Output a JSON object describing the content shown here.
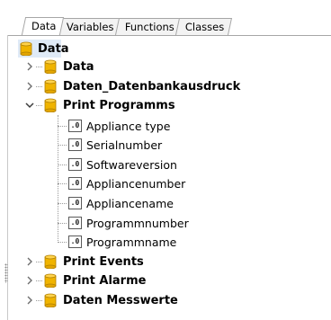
{
  "tabs": [
    {
      "label": "Data",
      "active": true
    },
    {
      "label": "Variables",
      "active": false
    },
    {
      "label": "Functions",
      "active": false
    },
    {
      "label": "Classes",
      "active": false
    }
  ],
  "tree": {
    "root": {
      "label": "Data",
      "icon": "database-icon"
    },
    "nodes": [
      {
        "label": "Data",
        "expanded": false
      },
      {
        "label": "Daten_Datenbankausdruck",
        "expanded": false
      },
      {
        "label": "Print Programms",
        "expanded": true,
        "children": [
          {
            "label": "Appliance type",
            "icon": "field-icon",
            "icon_text": ".0"
          },
          {
            "label": "Serialnumber",
            "icon": "field-icon",
            "icon_text": ".0"
          },
          {
            "label": "Softwareversion",
            "icon": "field-icon",
            "icon_text": ".0"
          },
          {
            "label": "Appliancenumber",
            "icon": "field-icon",
            "icon_text": ".0"
          },
          {
            "label": "Appliancename",
            "icon": "field-icon",
            "icon_text": ".0"
          },
          {
            "label": "Programmnumber",
            "icon": "field-icon",
            "icon_text": ".0"
          },
          {
            "label": "Programmname",
            "icon": "field-icon",
            "icon_text": ".0"
          }
        ]
      },
      {
        "label": "Print Events",
        "expanded": false
      },
      {
        "label": "Print Alarme",
        "expanded": false
      },
      {
        "label": "Daten Messwerte",
        "expanded": false
      }
    ]
  },
  "colors": {
    "selection": "#dfeaf7",
    "db_gold": "#f0b400"
  }
}
